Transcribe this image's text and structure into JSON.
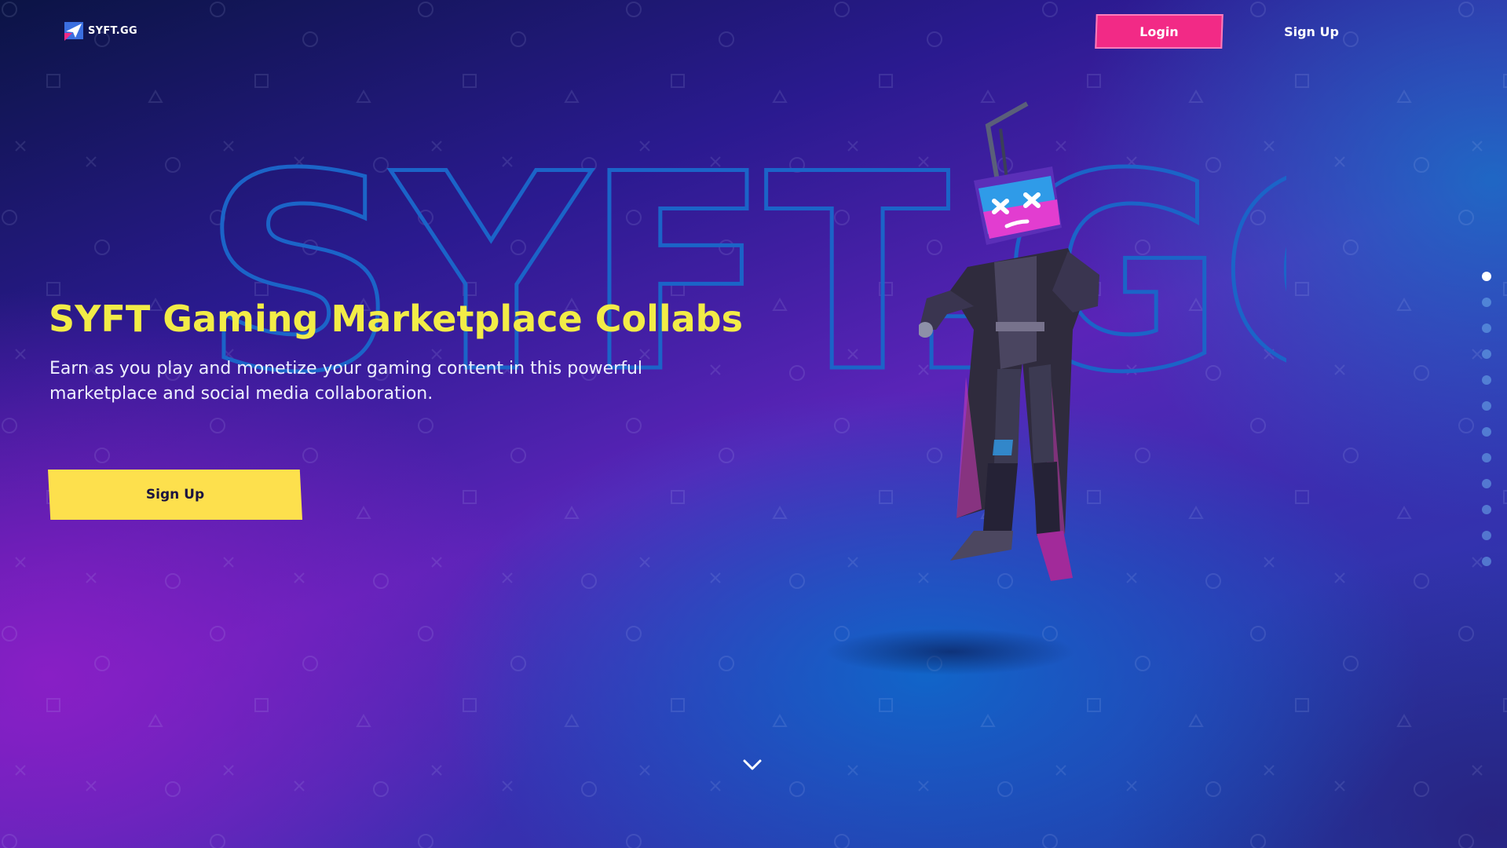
{
  "header": {
    "logo_text": "SYFT.GG",
    "login_label": "Login",
    "signup_label": "Sign Up"
  },
  "watermark_text": "SYFT.GG",
  "hero": {
    "title": "SYFT Gaming Marketplace Collabs",
    "subtitle_line1": "Earn as you play and monetize your gaming content in this powerful",
    "subtitle_line2": "marketplace and social media collaboration.",
    "cta_label": "Sign Up"
  },
  "slide_nav": {
    "count": 12,
    "active_index": 0
  },
  "colors": {
    "title_yellow": "#f2ec47",
    "login_pink": "#f22a86",
    "cta_yellow": "#fde04d"
  },
  "icons": {
    "logo": "paper-plane-logo-icon",
    "scroll": "chevron-down-icon"
  }
}
